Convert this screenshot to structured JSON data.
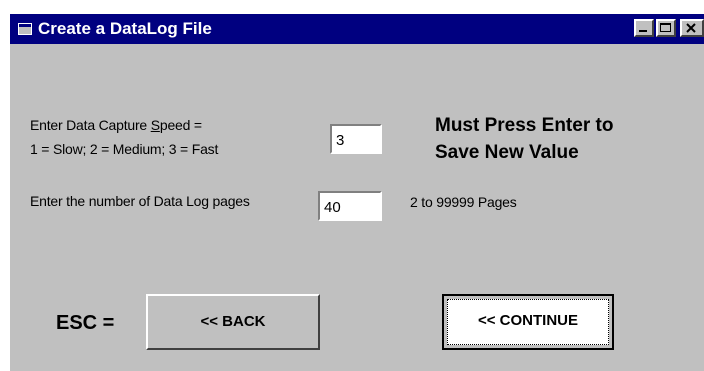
{
  "window": {
    "title": "Create a DataLog File"
  },
  "form": {
    "speed_label_prefix": "Enter Data Capture ",
    "speed_label_underlined": "S",
    "speed_label_suffix": "peed =",
    "speed_options_label": "1 = Slow; 2 = Medium; 3 = Fast",
    "speed_value": "3",
    "pages_label": "Enter the number of Data Log pages",
    "pages_value": "40",
    "pages_range": "2 to 99999 Pages",
    "warning_line1": "Must Press Enter to",
    "warning_line2": "Save New Value"
  },
  "buttons": {
    "esc_label": "ESC =",
    "back_label": "<< BACK",
    "continue_label": "<< CONTINUE"
  },
  "colors": {
    "titlebar": "#000080",
    "window_face": "#c0c0c0",
    "field_bg": "#ffffff"
  },
  "icons": {
    "app": "app-window-icon",
    "minimize": "minimize-icon",
    "maximize": "maximize-icon",
    "close": "close-icon"
  }
}
